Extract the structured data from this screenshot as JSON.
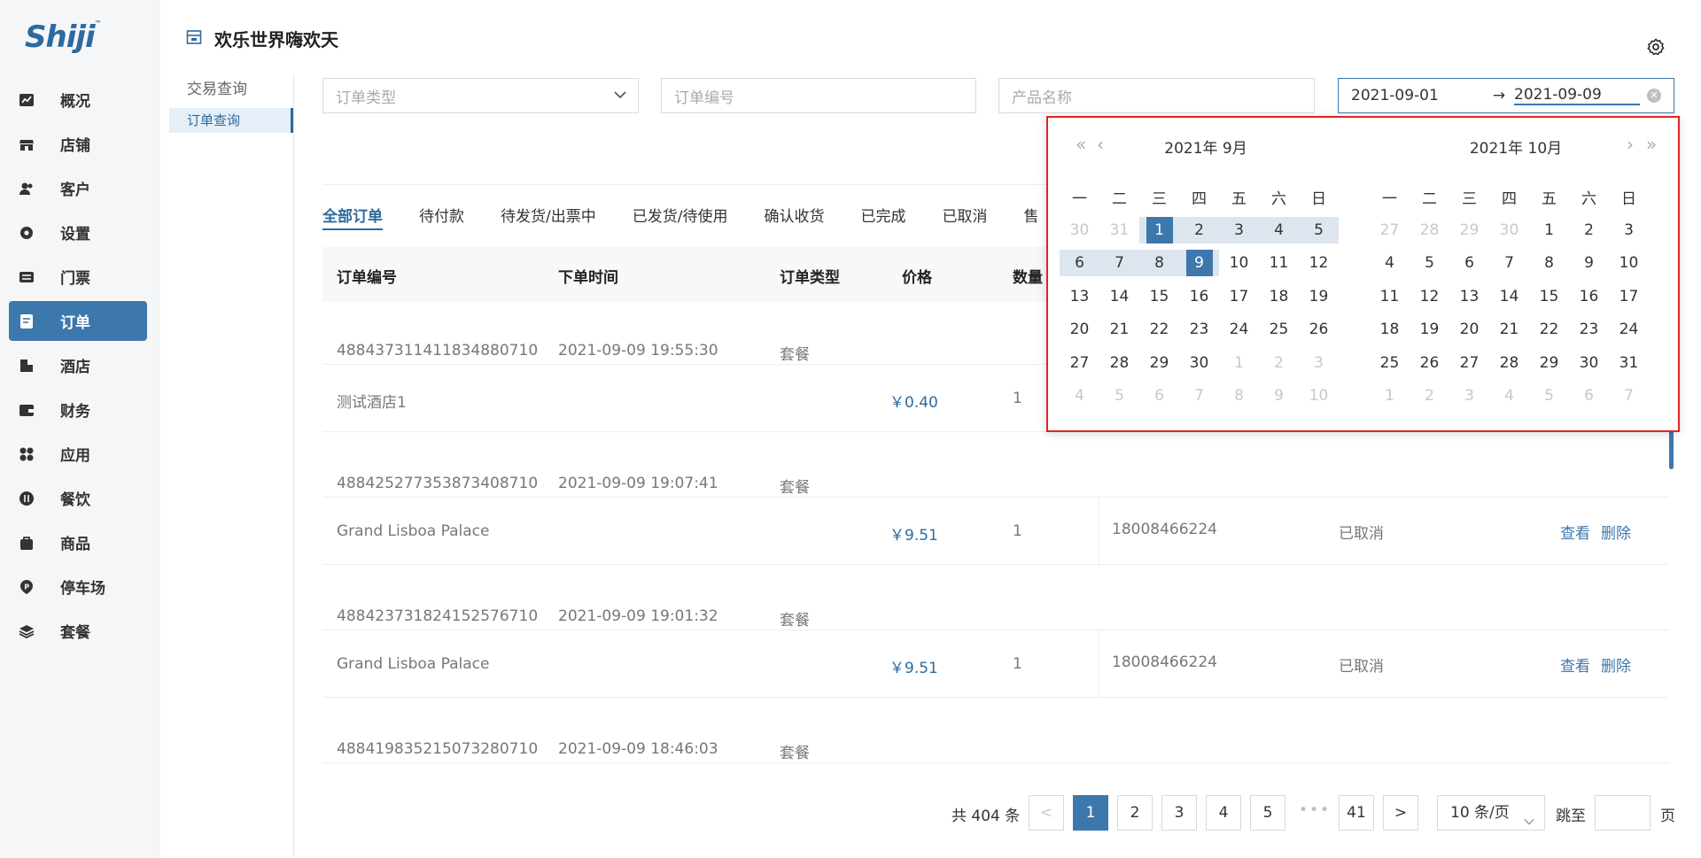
{
  "app": {
    "logo": "Shiji",
    "page_title": "欢乐世界嗨欢天"
  },
  "sidebar": {
    "items": [
      {
        "label": "概况",
        "icon": "chart-icon"
      },
      {
        "label": "店铺",
        "icon": "shop-icon"
      },
      {
        "label": "客户",
        "icon": "users-icon"
      },
      {
        "label": "设置",
        "icon": "gear-icon"
      },
      {
        "label": "门票",
        "icon": "ticket-icon"
      },
      {
        "label": "订单",
        "icon": "order-icon",
        "active": true
      },
      {
        "label": "酒店",
        "icon": "hotel-icon"
      },
      {
        "label": "财务",
        "icon": "wallet-icon"
      },
      {
        "label": "应用",
        "icon": "apps-icon"
      },
      {
        "label": "餐饮",
        "icon": "dining-icon"
      },
      {
        "label": "商品",
        "icon": "bag-icon"
      },
      {
        "label": "停车场",
        "icon": "parking-icon"
      },
      {
        "label": "套餐",
        "icon": "layers-icon"
      }
    ]
  },
  "submenu": {
    "group": "交易查询",
    "item": "订单查询"
  },
  "filters": {
    "order_type_placeholder": "订单类型",
    "order_no_placeholder": "订单编号",
    "product_placeholder": "产品名称",
    "date_start": "2021-09-01",
    "date_arrow": "→",
    "date_end": "2021-09-09"
  },
  "tabs": [
    "全部订单",
    "待付款",
    "待发货/出票中",
    "已发货/待使用",
    "确认收货",
    "已完成",
    "已取消",
    "售"
  ],
  "table": {
    "headers": [
      "订单编号",
      "下单时间",
      "订单类型",
      "价格",
      "数量"
    ],
    "orders": [
      {
        "no": "4884373114118348807​10",
        "time": "2021-09-09 19:55:30",
        "type": "套餐",
        "product": "测试酒店1",
        "price": "￥0.40",
        "qty": "1",
        "phone": "",
        "status": "",
        "view": "",
        "del": ""
      },
      {
        "no": "488425277353873408710",
        "time": "2021-09-09 19:07:41",
        "type": "套餐",
        "product": "Grand Lisboa Palace",
        "price": "￥9.51",
        "qty": "1",
        "phone": "18008466224",
        "status": "已取消",
        "view": "查看",
        "del": "删除"
      },
      {
        "no": "488423731824152576710",
        "time": "2021-09-09 19:01:32",
        "type": "套餐",
        "product": "Grand Lisboa Palace",
        "price": "￥9.51",
        "qty": "1",
        "phone": "18008466224",
        "status": "已取消",
        "view": "查看",
        "del": "删除"
      },
      {
        "no": "488419835215073280710",
        "time": "2021-09-09 18:46:03",
        "type": "套餐"
      }
    ]
  },
  "pagination": {
    "total": "共 404 条",
    "pages": [
      "1",
      "2",
      "3",
      "4",
      "5",
      "41"
    ],
    "prev": "<",
    "next": ">",
    "dots": "•••",
    "page_size": "10 条/页",
    "jump_label": "跳至",
    "page_label": "页",
    "current": "1"
  },
  "calendar": {
    "left_header": "2021年  9月",
    "right_header": "2021年  10月",
    "weekdays": [
      "一",
      "二",
      "三",
      "四",
      "五",
      "六",
      "日"
    ],
    "left_rows": [
      [
        "30",
        "31",
        "1",
        "2",
        "3",
        "4",
        "5"
      ],
      [
        "6",
        "7",
        "8",
        "9",
        "10",
        "11",
        "12"
      ],
      [
        "13",
        "14",
        "15",
        "16",
        "17",
        "18",
        "19"
      ],
      [
        "20",
        "21",
        "22",
        "23",
        "24",
        "25",
        "26"
      ],
      [
        "27",
        "28",
        "29",
        "30",
        "1",
        "2",
        "3"
      ],
      [
        "4",
        "5",
        "6",
        "7",
        "8",
        "9",
        "10"
      ]
    ],
    "right_rows": [
      [
        "27",
        "28",
        "29",
        "30",
        "1",
        "2",
        "3"
      ],
      [
        "4",
        "5",
        "6",
        "7",
        "8",
        "9",
        "10"
      ],
      [
        "11",
        "12",
        "13",
        "14",
        "15",
        "16",
        "17"
      ],
      [
        "18",
        "19",
        "20",
        "21",
        "22",
        "23",
        "24"
      ],
      [
        "25",
        "26",
        "27",
        "28",
        "29",
        "30",
        "31"
      ],
      [
        "1",
        "2",
        "3",
        "4",
        "5",
        "6",
        "7"
      ]
    ],
    "accent": "#3d78ad",
    "range_bg": "#dde6ee",
    "highlight_border": "#e02424"
  }
}
